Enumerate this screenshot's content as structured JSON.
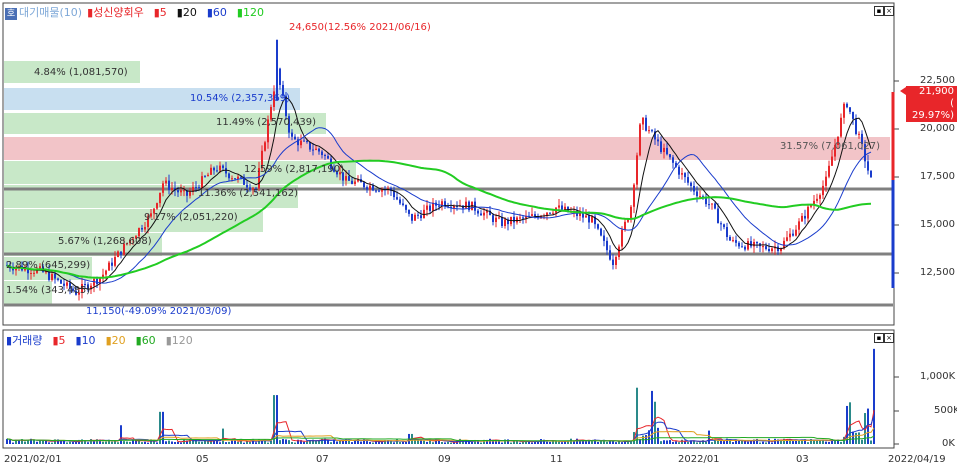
{
  "upper_legend": {
    "volume_leaders": "대기매물(10)",
    "stock_name": "성신양회우",
    "ma5": "5",
    "ma20": "20",
    "ma60": "60",
    "ma120": "120"
  },
  "lower_legend": {
    "title": "거래량",
    "ma5": "5",
    "ma10": "10",
    "ma20": "20",
    "ma60": "60",
    "ma120": "120"
  },
  "high_annotation": "24,650(12.56% 2021/06/16)",
  "low_annotation": "11,150(-49.09% 2021/03/09)",
  "current_price": "21,900",
  "current_change": "( 29.97%)",
  "corner_button": "호",
  "volume_profile": [
    {
      "label": "4.84% (1,081,570)"
    },
    {
      "label": "10.54% (2,357,369)"
    },
    {
      "label": "11.49% (2,570,439)"
    },
    {
      "label": "31.57% (7,061,027)"
    },
    {
      "label": "12.59% (2,817,190)"
    },
    {
      "label": "11.36% (2,541,162)"
    },
    {
      "label": "9.17% (2,051,220)"
    },
    {
      "label": "5.67% (1,268,608)"
    },
    {
      "label": "2.89% (645,299)"
    },
    {
      "label": "1.54% (343,485)"
    }
  ],
  "price_axis": [
    "22,500",
    "20,000",
    "17,500",
    "15,000",
    "12,500"
  ],
  "volume_axis": [
    "1,000K",
    "500K",
    "0K"
  ],
  "date_axis": [
    "2021/02/01",
    "05",
    "07",
    "09",
    "11",
    "2022/01",
    "03",
    "2022/04/19"
  ],
  "colors": {
    "up": "#e8262a",
    "down": "#1a3ccc",
    "ma5": "#111111",
    "ma20": "#1a3ccc",
    "ma60": "#22cc22",
    "ma120": "#999999",
    "band_green": "#c8e8c8",
    "band_blue": "#c8dff0",
    "band_pink": "#f2c4c8"
  }
}
